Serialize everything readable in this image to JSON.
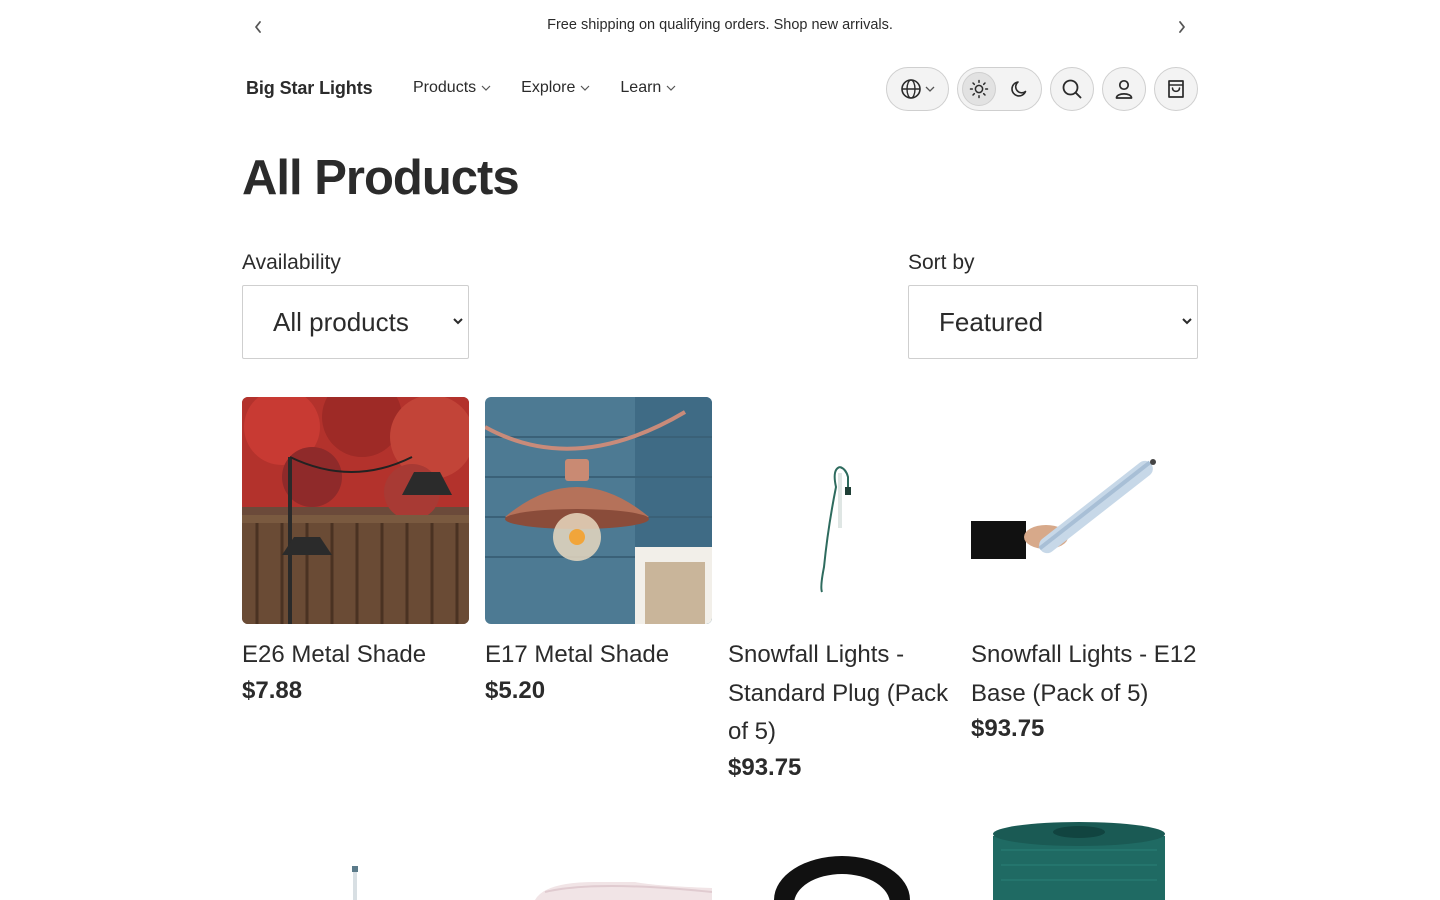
{
  "announcement": {
    "message": "Free shipping on qualifying orders. Shop new arrivals.",
    "prev_icon": "chevron-left-icon",
    "next_icon": "chevron-right-icon"
  },
  "header": {
    "logo": "Big Star Lights",
    "nav": [
      {
        "label": "Products"
      },
      {
        "label": "Explore"
      },
      {
        "label": "Learn"
      }
    ],
    "icons": {
      "locale": "globe-icon",
      "theme_light": "sun-icon",
      "theme_dark": "moon-icon",
      "search": "search-icon",
      "account": "user-icon",
      "cart": "shopping-bag-icon"
    }
  },
  "main": {
    "title": "All Products",
    "filters": {
      "availability_label": "Availability",
      "availability_value": "All products",
      "sort_label": "Sort by",
      "sort_value": "Featured"
    },
    "products": [
      {
        "name": "E26 Metal Shade",
        "price": "$7.88"
      },
      {
        "name": "E17 Metal Shade",
        "price": "$5.20"
      },
      {
        "name": "Snowfall Lights - Standard Plug (Pack of 5)",
        "price": "$93.75"
      },
      {
        "name": "Snowfall Lights - E12 Base (Pack of 5)",
        "price": "$93.75"
      }
    ]
  },
  "colors": {
    "text": "#2b2b2b",
    "border": "#cfcfcf",
    "button_bg": "#f3f3f3"
  }
}
